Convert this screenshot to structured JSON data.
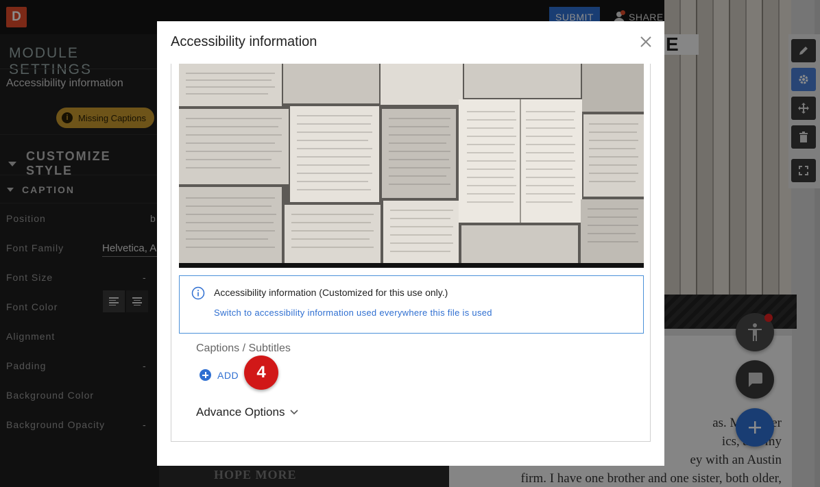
{
  "app": {
    "logo_letter": "D",
    "submit_label": "SUBMIT",
    "share_label": "SHARE"
  },
  "sidebar": {
    "title": "MODULE SETTINGS",
    "accessibility_label": "Accessibility information",
    "missing_badge": "Missing Captions",
    "customize_heading": "CUSTOMIZE STYLE",
    "caption_heading": "CAPTION",
    "properties": [
      {
        "label": "Position",
        "value": "b"
      },
      {
        "label": "Font Family",
        "value": "Helvetica, A"
      },
      {
        "label": "Font Size",
        "value": "-"
      },
      {
        "label": "Font Color",
        "value": ""
      },
      {
        "label": "Alignment",
        "value": ""
      },
      {
        "label": "Padding",
        "value": "-"
      },
      {
        "label": "Background Color",
        "value": ""
      },
      {
        "label": "Background Opacity",
        "value": "-"
      }
    ]
  },
  "page": {
    "header_fragment": "E",
    "paragraph": "as. My father\nics, and my\ney with an Austin\nfirm. I have one brother and one sister, both older,",
    "bottom_text": "HOPE MORE"
  },
  "modal": {
    "title": "Accessibility information",
    "info_text": "Accessibility information (Customized for this use only.)",
    "info_link": "Switch to accessibility information used everywhere this file is used",
    "captions_label": "Captions / Subtitles",
    "add_label": "ADD",
    "step_number": "4",
    "advance_label": "Advance Options"
  },
  "colors": {
    "accent": "#2f6fd1",
    "badge": "#c89a2e",
    "step": "#d11818",
    "brand": "#e24b2a"
  },
  "icons": [
    "close-icon",
    "info-icon",
    "plus-circle-icon",
    "chevron-down-icon",
    "pencil-icon",
    "gear-icon",
    "move-icon",
    "trash-icon",
    "fullscreen-icon",
    "accessibility-icon",
    "chat-icon",
    "plus-icon",
    "menu-icon",
    "user-icon"
  ]
}
